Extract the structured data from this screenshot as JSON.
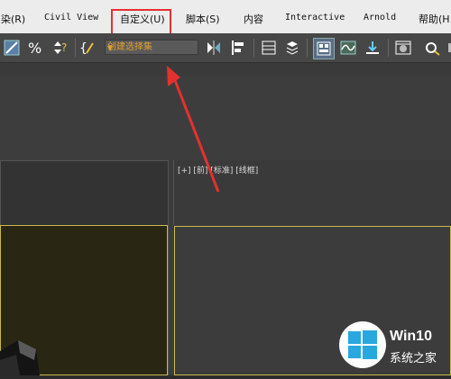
{
  "menubar": {
    "items": [
      {
        "label": "染(R)"
      },
      {
        "label": "Civil View"
      },
      {
        "label": "自定义(U)"
      },
      {
        "label": "脚本(S)"
      },
      {
        "label": "内容"
      },
      {
        "label": "Interactive"
      },
      {
        "label": "Arnold"
      },
      {
        "label": "帮助(H"
      }
    ]
  },
  "toolbar": {
    "selection_set_placeholder": "创建选择集",
    "icons": [
      "snap-angle-icon",
      "percent-snap-icon",
      "spinner-snap-icon",
      "edit-named-sets-icon",
      "mirror-icon",
      "align-icon",
      "layer-manager-icon",
      "toggle-scene-explorer-icon",
      "ribbon-icon",
      "curve-editor-icon",
      "schematic-view-icon",
      "material-editor-icon",
      "render-setup-icon",
      "render-icon"
    ]
  },
  "viewport": {
    "label": "[+] [前] [标准] [线框]"
  },
  "watermark": {
    "brand": "Win10",
    "subtitle": "系统之家"
  },
  "colors": {
    "annotation_red": "#e53030",
    "viewport_border_active": "#c9b84a",
    "selection_text": "#e0a030"
  }
}
